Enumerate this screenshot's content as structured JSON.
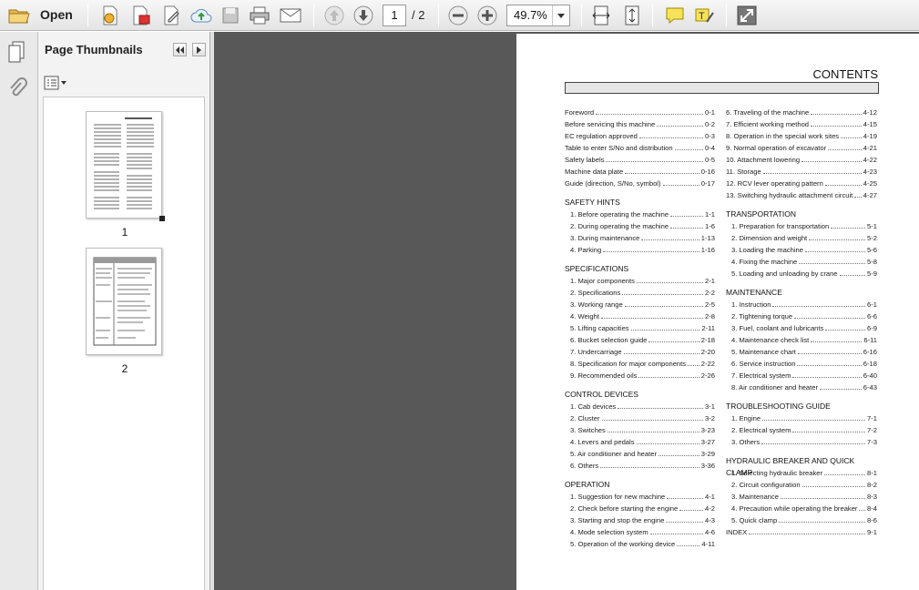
{
  "toolbar": {
    "open_label": "Open",
    "current_page": "1",
    "total_pages": "/ 2",
    "zoom": "49.7%"
  },
  "panel": {
    "title": "Page Thumbnails",
    "thumbnails": [
      {
        "label": "1"
      },
      {
        "label": "2"
      }
    ]
  },
  "document": {
    "title": "CONTENTS",
    "left_top": [
      {
        "label": "Foreword",
        "page": "0-1"
      },
      {
        "label": "Before servicing this machine",
        "page": "0-2"
      },
      {
        "label": "EC regulation approved",
        "page": "0-3"
      },
      {
        "label": "Table to enter S/No and distribution",
        "page": "0-4"
      },
      {
        "label": "Safety labels",
        "page": "0-5"
      },
      {
        "label": "Machine data plate",
        "page": "0-16"
      },
      {
        "label": "Guide (direction, S/No, symbol)",
        "page": "0-17"
      }
    ],
    "left_sections": [
      {
        "heading": "SAFETY HINTS",
        "items": [
          {
            "label": "1. Before operating the machine",
            "page": "1-1"
          },
          {
            "label": "2. During operating the machine",
            "page": "1-6"
          },
          {
            "label": "3. During maintenance",
            "page": "1-13"
          },
          {
            "label": "4. Parking",
            "page": "1-16"
          }
        ]
      },
      {
        "heading": "SPECIFICATIONS",
        "items": [
          {
            "label": "1. Major components",
            "page": "2-1"
          },
          {
            "label": "2. Specifications",
            "page": "2-2"
          },
          {
            "label": "3. Working range",
            "page": "2-5"
          },
          {
            "label": "4. Weight",
            "page": "2-8"
          },
          {
            "label": "5. Lifting capacities",
            "page": "2-11"
          },
          {
            "label": "6. Bucket selection guide",
            "page": "2-18"
          },
          {
            "label": "7. Undercarriage",
            "page": "2-20"
          },
          {
            "label": "8. Specification for major components",
            "page": "2-22"
          },
          {
            "label": "9. Recommended oils",
            "page": "2-26"
          }
        ]
      },
      {
        "heading": "CONTROL DEVICES",
        "items": [
          {
            "label": "1. Cab devices",
            "page": "3-1"
          },
          {
            "label": "2. Cluster",
            "page": "3-2"
          },
          {
            "label": "3. Switches",
            "page": "3-23"
          },
          {
            "label": "4. Levers and pedals",
            "page": "3-27"
          },
          {
            "label": "5. Air conditioner and heater",
            "page": "3-29"
          },
          {
            "label": "6. Others",
            "page": "3-36"
          }
        ]
      },
      {
        "heading": "OPERATION",
        "items": [
          {
            "label": "1. Suggestion for new machine",
            "page": "4-1"
          },
          {
            "label": "2. Check before starting the engine",
            "page": "4-2"
          },
          {
            "label": "3. Starting and stop the engine",
            "page": "4-3"
          },
          {
            "label": "4. Mode selection system",
            "page": "4-6"
          },
          {
            "label": "5. Operation of the working device",
            "page": "4-11"
          }
        ]
      }
    ],
    "right_top": [
      {
        "label": "6. Traveling of the machine",
        "page": "4-12"
      },
      {
        "label": "7. Efficient working method",
        "page": "4-15"
      },
      {
        "label": "8. Operation in the special work sites",
        "page": "4-19"
      },
      {
        "label": "9. Normal operation of excavator",
        "page": "4-21"
      },
      {
        "label": "10. Attachment lowering",
        "page": "4-22"
      },
      {
        "label": "11. Storage",
        "page": "4-23"
      },
      {
        "label": "12. RCV lever operating pattern",
        "page": "4-25"
      },
      {
        "label": "13. Switching hydraulic attachment circuit",
        "page": "4-27"
      }
    ],
    "right_sections": [
      {
        "heading": "TRANSPORTATION",
        "items": [
          {
            "label": "1. Preparation for transportation",
            "page": "5-1"
          },
          {
            "label": "2. Dimension and weight",
            "page": "5-2"
          },
          {
            "label": "3. Loading the machine",
            "page": "5-6"
          },
          {
            "label": "4. Fixing the machine",
            "page": "5-8"
          },
          {
            "label": "5. Loading and unloading by crane",
            "page": "5-9"
          }
        ]
      },
      {
        "heading": "MAINTENANCE",
        "items": [
          {
            "label": "1. Instruction",
            "page": "6-1"
          },
          {
            "label": "2. Tightening torque",
            "page": "6-6"
          },
          {
            "label": "3. Fuel, coolant and lubricants",
            "page": "6-9"
          },
          {
            "label": "4. Maintenance check list",
            "page": "6-11"
          },
          {
            "label": "5. Maintenance chart",
            "page": "6-16"
          },
          {
            "label": "6. Service instruction",
            "page": "6-18"
          },
          {
            "label": "7. Electrical system",
            "page": "6-40"
          },
          {
            "label": "8. Air conditioner and heater",
            "page": "6-43"
          }
        ]
      },
      {
        "heading": "TROUBLESHOOTING GUIDE",
        "items": [
          {
            "label": "1. Engine",
            "page": "7-1"
          },
          {
            "label": "2. Electrical system",
            "page": "7-2"
          },
          {
            "label": "3. Others",
            "page": "7-3"
          }
        ]
      },
      {
        "heading": "HYDRAULIC BREAKER AND QUICK CLAMP",
        "items": [
          {
            "label": "1. Selecting hydraulic breaker",
            "page": "8-1"
          },
          {
            "label": "2. Circuit configuration",
            "page": "8-2"
          },
          {
            "label": "3. Maintenance",
            "page": "8-3"
          },
          {
            "label": "4. Precaution while operating the breaker",
            "page": "8-4"
          },
          {
            "label": "5. Quick clamp",
            "page": "8-6"
          }
        ]
      }
    ],
    "index": {
      "label": "INDEX",
      "page": "9-1"
    }
  }
}
